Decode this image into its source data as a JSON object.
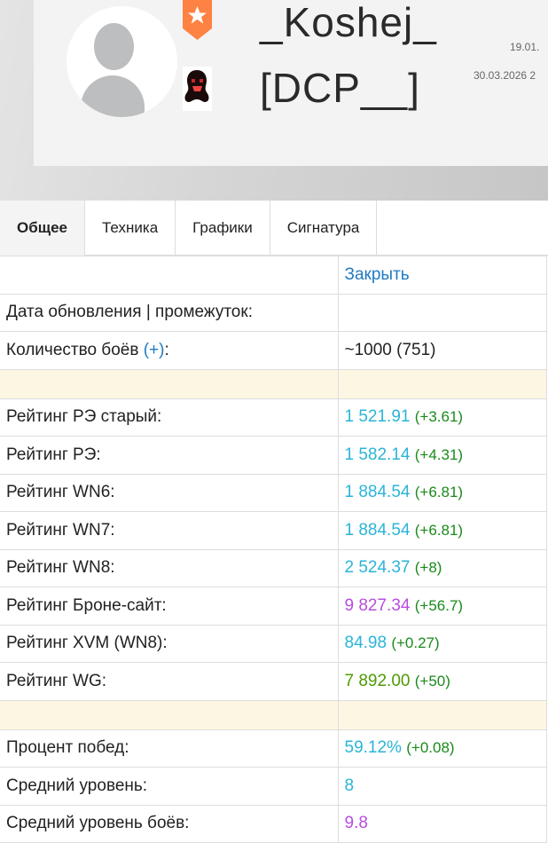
{
  "profile": {
    "name": "_Koshej_",
    "clan": "[DCP__]",
    "date_registered": "19.01.",
    "date_last": "30.03.2026 2"
  },
  "tabs": [
    {
      "label": "Общее"
    },
    {
      "label": "Техника"
    },
    {
      "label": "Графики"
    },
    {
      "label": "Сигнатура"
    }
  ],
  "table": {
    "close_label": "Закрыть",
    "update_label": "Дата обновления | промежуток:",
    "battles_label": "Количество боёв ",
    "battles_plus": "(+)",
    "battles_colon": ":",
    "battles_value": "~1000 (751)",
    "ratings": [
      {
        "label": "Рейтинг РЭ старый:",
        "value": "1 521.91",
        "delta": "(+3.61)",
        "color": "cyan"
      },
      {
        "label": "Рейтинг РЭ:",
        "value": "1 582.14",
        "delta": "(+4.31)",
        "color": "cyan"
      },
      {
        "label": "Рейтинг WN6:",
        "value": "1 884.54",
        "delta": "(+6.81)",
        "color": "cyan"
      },
      {
        "label": "Рейтинг WN7:",
        "value": "1 884.54",
        "delta": "(+6.81)",
        "color": "cyan"
      },
      {
        "label": "Рейтинг WN8:",
        "value": "2 524.37",
        "delta": "(+8)",
        "color": "cyan"
      },
      {
        "label": "Рейтинг Броне-сайт:",
        "value": "9 827.34",
        "delta": "(+56.7)",
        "color": "purple"
      },
      {
        "label": "Рейтинг XVM (WN8):",
        "value": "84.98",
        "delta": "(+0.27)",
        "color": "cyan"
      },
      {
        "label": "Рейтинг WG:",
        "value": "7 892.00",
        "delta": "(+50)",
        "color": "green"
      }
    ],
    "stats": [
      {
        "label": "Процент побед:",
        "value": "59.12%",
        "delta": "(+0.08)",
        "color": "cyan"
      },
      {
        "label": "Средний уровень:",
        "value": "8",
        "delta": "",
        "color": "cyan"
      },
      {
        "label": "Средний уровень боёв:",
        "value": "9.8",
        "delta": "",
        "color": "purple"
      }
    ]
  }
}
